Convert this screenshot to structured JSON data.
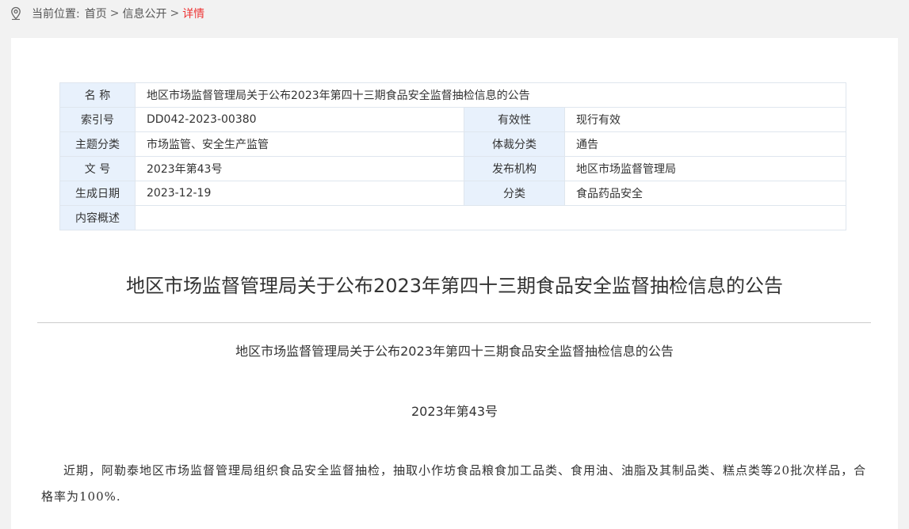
{
  "breadcrumb": {
    "prefix": "当前位置:",
    "home": "首页",
    "section": "信息公开",
    "current": "详情",
    "separator": ">"
  },
  "meta": {
    "name_label": "名 称",
    "name_value": "地区市场监督管理局关于公布2023年第四十三期食品安全监督抽检信息的公告",
    "index_label": "索引号",
    "index_value": "DD042-2023-00380",
    "validity_label": "有效性",
    "validity_value": "现行有效",
    "topic_label": "主题分类",
    "topic_value": "市场监管、安全生产监管",
    "genre_label": "体裁分类",
    "genre_value": "通告",
    "docno_label": "文 号",
    "docno_value": "2023年第43号",
    "issuer_label": "发布机构",
    "issuer_value": "地区市场监督管理局",
    "date_label": "生成日期",
    "date_value": "2023-12-19",
    "category_label": "分类",
    "category_value": "食品药品安全",
    "summary_label": "内容概述",
    "summary_value": ""
  },
  "article": {
    "title": "地区市场监督管理局关于公布2023年第四十三期食品安全监督抽检信息的公告",
    "subtitle": "地区市场监督管理局关于公布2023年第四十三期食品安全监督抽检信息的公告",
    "doc_number": "2023年第43号",
    "paragraph": "近期，阿勒泰地区市场监督管理局组织食品安全监督抽检，抽取小作坊食品粮食加工品类、食用油、油脂及其制品类、糕点类等20批次样品，合格率为100%."
  },
  "colors": {
    "accent_current": "#e33333",
    "label_bg": "#e8f1fc",
    "page_bg": "#f2f2f2"
  },
  "icons": {
    "location": "location-pin-icon"
  }
}
